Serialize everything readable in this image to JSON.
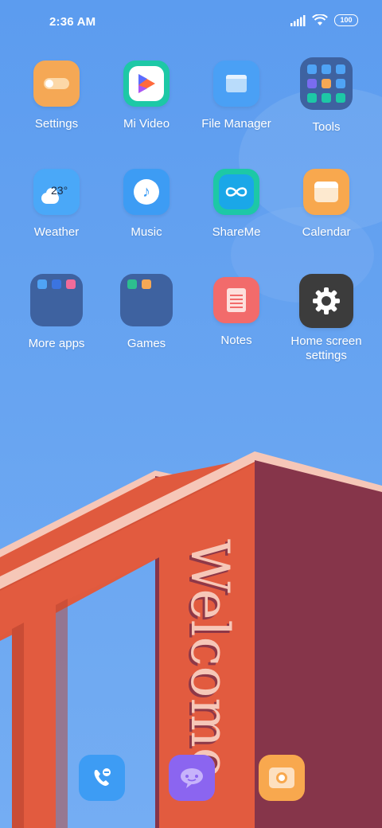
{
  "status": {
    "time": "2:36 AM",
    "battery": "100",
    "signal_icon": "signal-icon",
    "wifi_icon": "wifi-icon"
  },
  "apps": [
    {
      "label": "Settings",
      "icon": "settings-toggle-icon",
      "color": "#f5a855"
    },
    {
      "label": "Mi Video",
      "icon": "play-icon",
      "color": "#1dc8a6"
    },
    {
      "label": "File Manager",
      "icon": "folder-icon",
      "color": "#4aa0f5"
    },
    {
      "label": "Tools",
      "icon": "tools-folder-icon",
      "color": "#3e62a0"
    },
    {
      "label": "Weather",
      "icon": "weather-icon",
      "color": "#4aa8f8",
      "value": "23°"
    },
    {
      "label": "Music",
      "icon": "music-icon",
      "color": "#3d9cf4"
    },
    {
      "label": "ShareMe",
      "icon": "infinity-icon",
      "color": "#1aa7e8"
    },
    {
      "label": "Calendar",
      "icon": "calendar-icon",
      "color": "#f8a84e"
    },
    {
      "label": "More apps",
      "icon": "more-apps-folder-icon",
      "color": "#3e62a0"
    },
    {
      "label": "Games",
      "icon": "games-folder-icon",
      "color": "#3e62a0"
    },
    {
      "label": "Notes",
      "icon": "notes-icon",
      "color": "#f26b6b"
    },
    {
      "label": "Home screen settings",
      "icon": "gear-icon",
      "color": "#3c3c3c"
    }
  ],
  "wallpaper": {
    "text": "Welcome",
    "building_color": "#e05a3e",
    "building_dark": "#86354a"
  },
  "dock": [
    {
      "icon": "phone-icon",
      "color": "#3d9cf4"
    },
    {
      "icon": "message-icon",
      "color": "#8b65f0"
    },
    {
      "icon": "camera-icon",
      "color": "#f8a84e"
    }
  ]
}
